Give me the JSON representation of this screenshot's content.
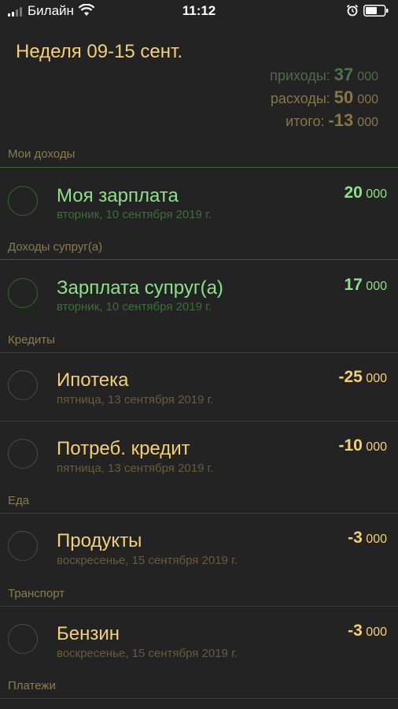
{
  "status": {
    "carrier": "Билайн",
    "time": "11:12"
  },
  "header": {
    "title": "Неделя 09-15 сент.",
    "income_label": "приходы:",
    "income_value": "37",
    "income_thousands": "000",
    "expense_label": "расходы:",
    "expense_value": "50",
    "expense_thousands": "000",
    "total_label": "итого:",
    "total_value": "-13",
    "total_thousands": "000"
  },
  "sections": [
    {
      "label": "Мои доходы"
    },
    {
      "label": "Доходы супруг(а)"
    },
    {
      "label": "Кредиты"
    },
    {
      "label": "Еда"
    },
    {
      "label": "Транспорт"
    },
    {
      "label": "Платежи"
    }
  ],
  "items": [
    {
      "title": "Моя зарплата",
      "date": "вторник, 10 сентября 2019 г.",
      "amount": "20",
      "thousands": "000",
      "type": "income"
    },
    {
      "title": "Зарплата супруг(а)",
      "date": "вторник, 10 сентября 2019 г.",
      "amount": "17",
      "thousands": "000",
      "type": "income"
    },
    {
      "title": "Ипотека",
      "date": "пятница, 13 сентября 2019 г.",
      "amount": "-25",
      "thousands": "000",
      "type": "expense"
    },
    {
      "title": "Потреб. кредит",
      "date": "пятница, 13 сентября 2019 г.",
      "amount": "-10",
      "thousands": "000",
      "type": "expense"
    },
    {
      "title": "Продукты",
      "date": "воскресенье, 15 сентября 2019 г.",
      "amount": "-3",
      "thousands": "000",
      "type": "expense"
    },
    {
      "title": "Бензин",
      "date": "воскресенье, 15 сентября 2019 г.",
      "amount": "-3",
      "thousands": "000",
      "type": "expense"
    }
  ],
  "colors": {
    "background": "#232323",
    "income": "#8fe08b",
    "expense": "#f3cf7c"
  }
}
